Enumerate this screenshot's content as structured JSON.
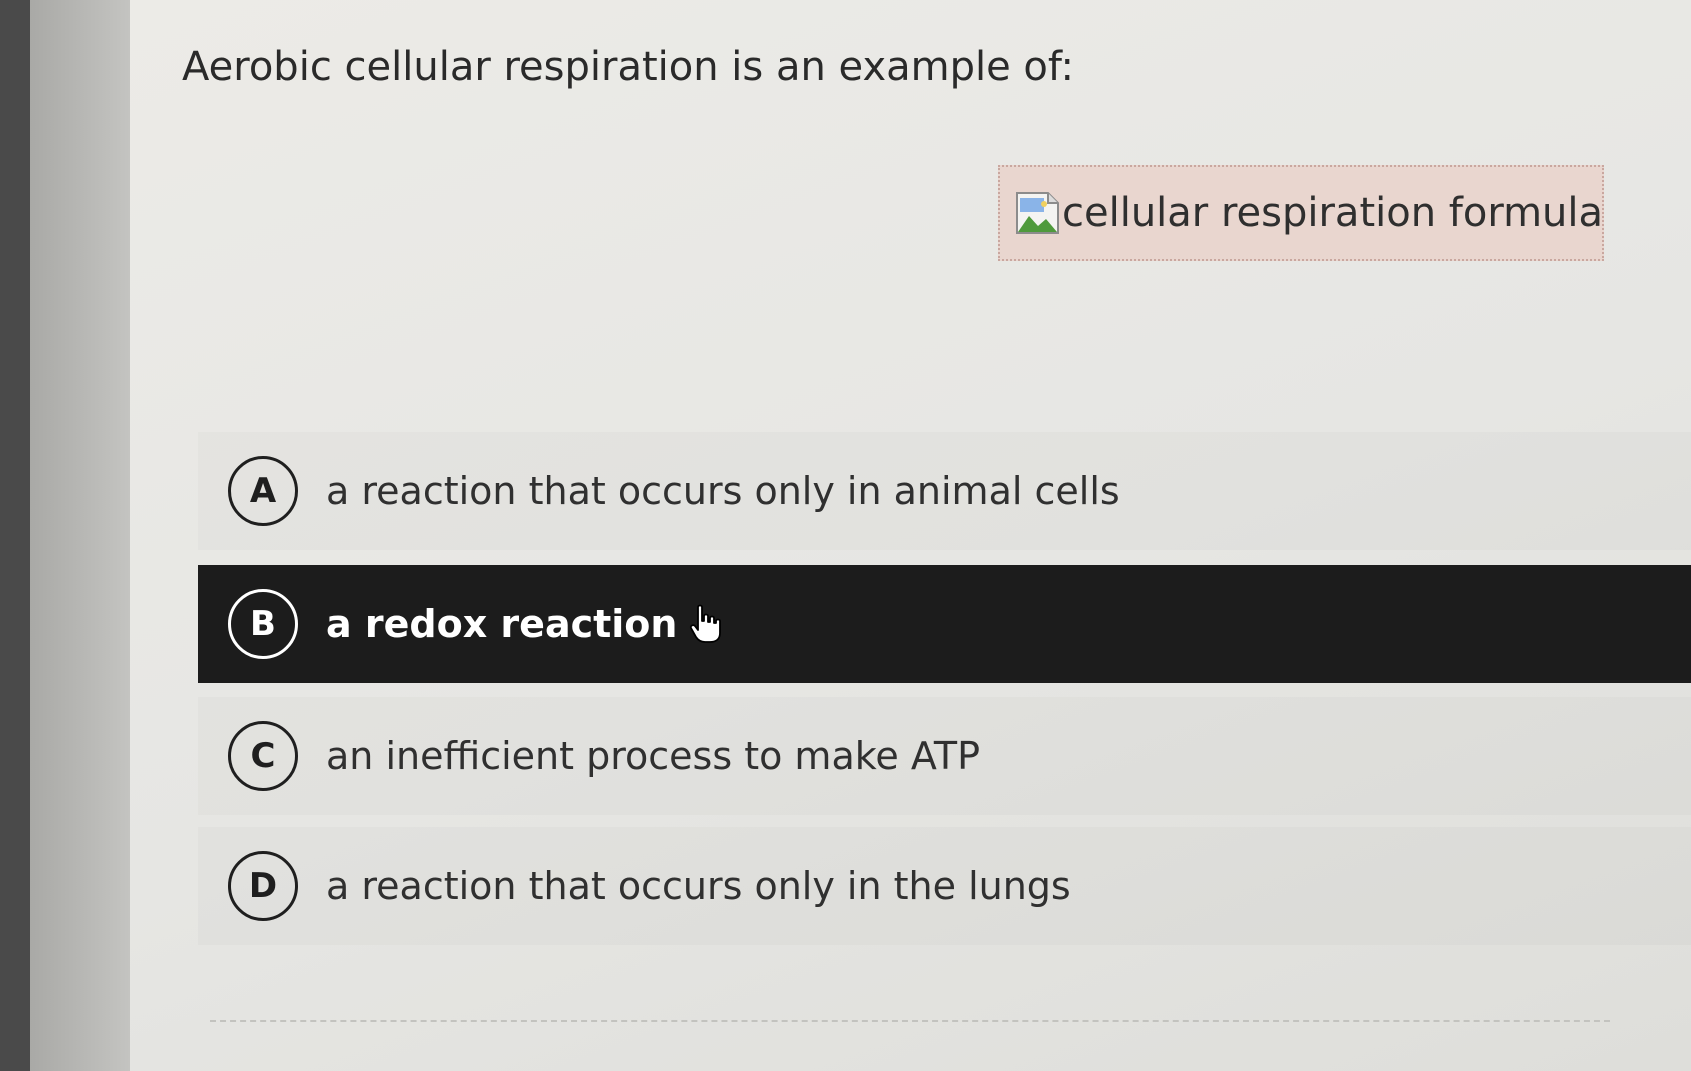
{
  "question": "Aerobic cellular respiration is an example of:",
  "figure": {
    "alt_text": "cellular respiration formula",
    "icon": "broken-image-icon"
  },
  "options": [
    {
      "letter": "A",
      "text": "a reaction that occurs only in animal cells",
      "selected": false
    },
    {
      "letter": "B",
      "text": "a redox reaction",
      "selected": true
    },
    {
      "letter": "C",
      "text": "an inefficient process to make ATP",
      "selected": false
    },
    {
      "letter": "D",
      "text": "a reaction that occurs only in the lungs",
      "selected": false
    }
  ],
  "cursor": "hand-pointer-icon",
  "colors": {
    "selected_background": "#1c1c1c",
    "figure_background": "#e9d6cf",
    "page_background": "#e8e8e4"
  }
}
